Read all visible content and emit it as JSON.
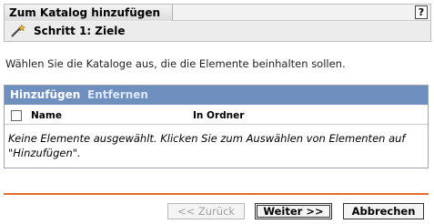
{
  "dialog": {
    "title": "Zum Katalog hinzufügen",
    "help_label": "?",
    "step_label": "Schritt 1: Ziele"
  },
  "instruction": "Wählen Sie die Kataloge aus, die die Elemente beinhalten sollen.",
  "panel": {
    "toolbar": {
      "add_label": "Hinzufügen",
      "remove_label": "Entfernen"
    },
    "columns": {
      "name": "Name",
      "folder": "In Ordner"
    },
    "empty_message": "Keine Elemente ausgewählt. Klicken Sie zum Auswählen von Elementen auf \"Hinzufügen\"."
  },
  "buttons": {
    "back": "<< Zurück",
    "next": "Weiter >>",
    "cancel": "Abbrechen"
  },
  "colors": {
    "toolbar_bg": "#6f8fbe",
    "separator": "#e56b2e"
  },
  "icons": {
    "step": "wand-icon",
    "help": "help-icon"
  }
}
